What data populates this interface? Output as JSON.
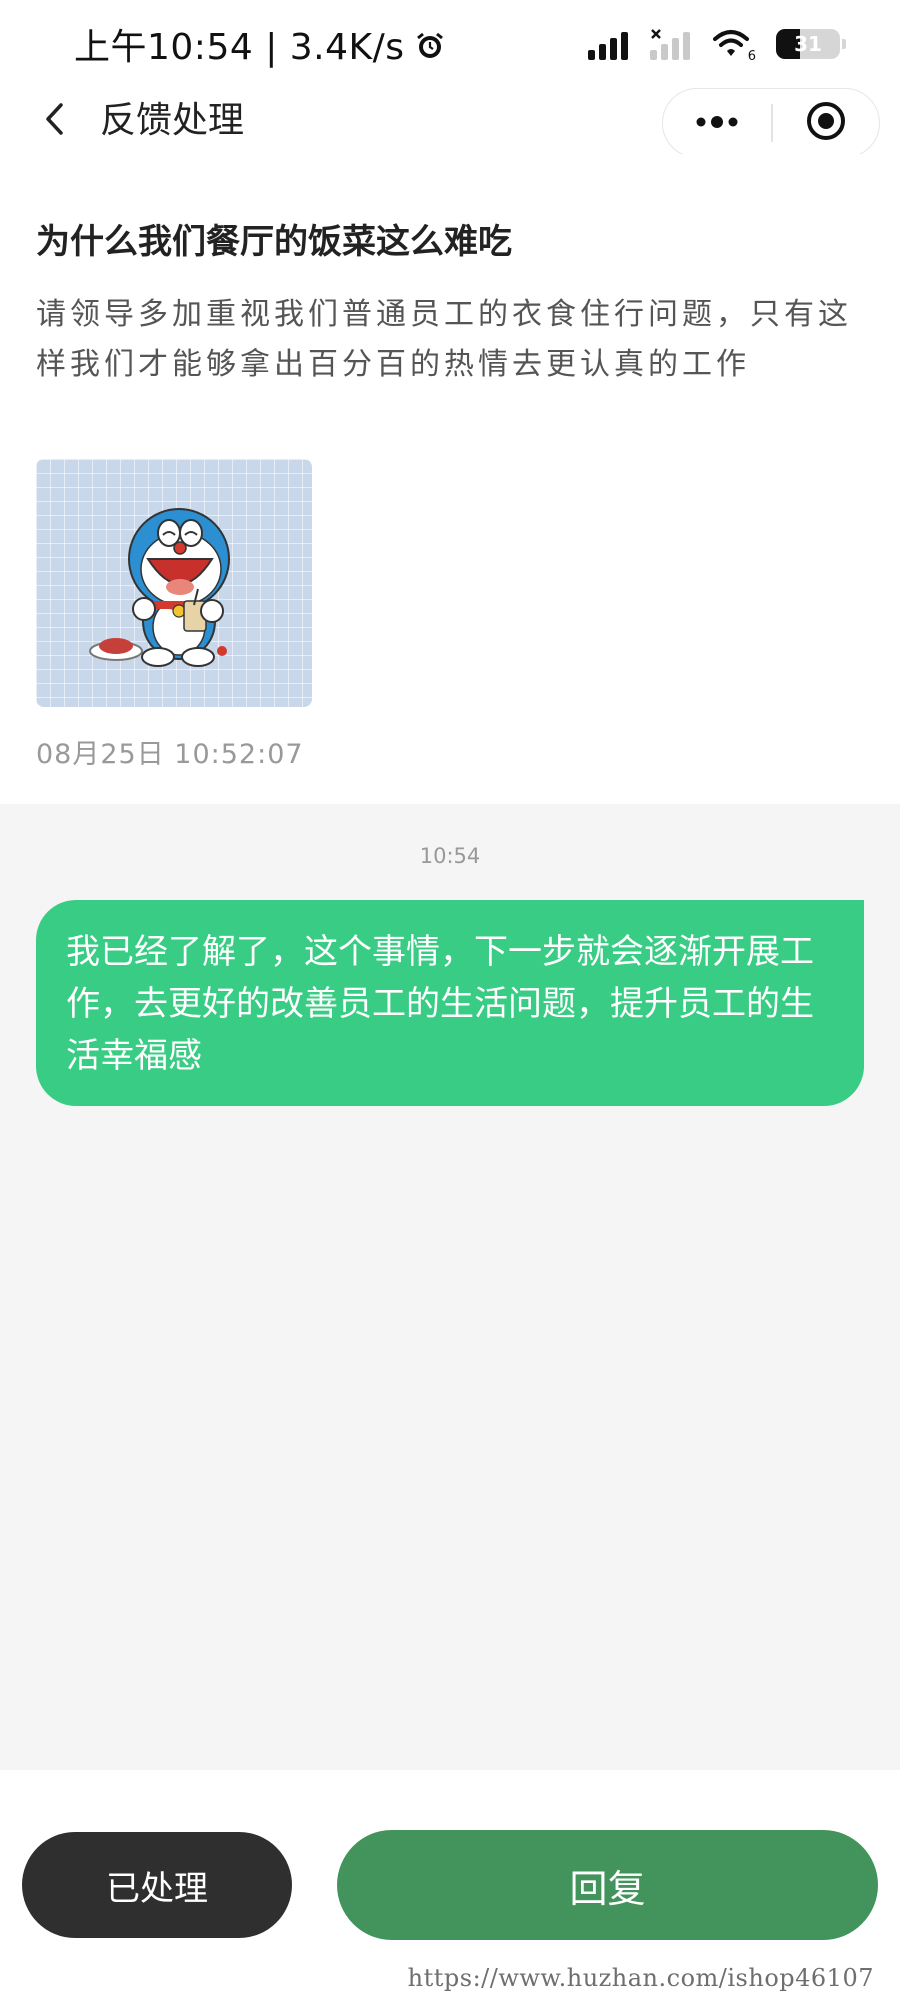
{
  "status_bar": {
    "time_speed": "上午10:54 | 3.4K/s",
    "wifi_label": "6",
    "battery_level": "31",
    "icons": [
      "alarm-icon",
      "cell-signal-icon",
      "cell-signal-off-icon",
      "wifi-icon",
      "battery-icon"
    ]
  },
  "nav": {
    "title": "反馈处理",
    "back_icon": "chevron-left-icon",
    "more_icon": "more-dots-icon",
    "close_icon": "target-close-icon"
  },
  "feedback": {
    "title": "为什么我们餐厅的饭菜这么难吃",
    "content": "请领导多加重视我们普通员工的衣食住行问题，只有这样我们才能够拿出百分百的热情去更认真的工作",
    "time": "08月25日 10:52:07"
  },
  "chat": {
    "time": "10:54",
    "reply": "我已经了解了，这个事情，下一步就会逐渐开展工作，去更好的改善员工的生活问题，提升员工的生活幸福感"
  },
  "actions": {
    "processed_label": "已处理",
    "reply_label": "回复"
  },
  "watermark": "https://www.huzhan.com/ishop46107",
  "colors": {
    "reply_bubble": "#39cc84",
    "reply_button": "#43935d",
    "processed_button": "#2f2f2f",
    "chat_background": "#f5f5f5"
  }
}
